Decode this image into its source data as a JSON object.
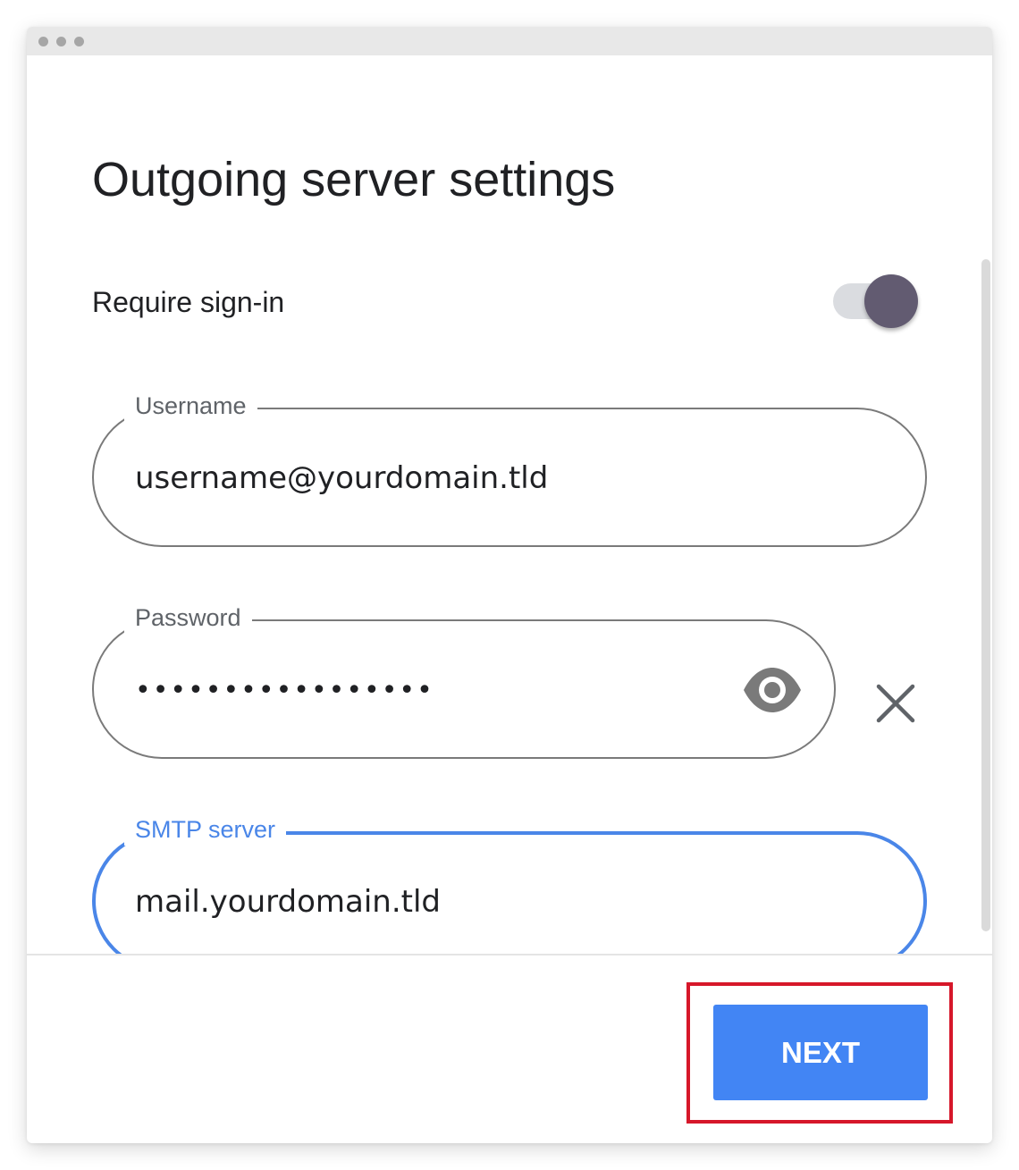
{
  "window": {
    "controls": [
      "window-dot-icon",
      "window-dot-icon",
      "window-dot-icon"
    ]
  },
  "page": {
    "title": "Outgoing server settings"
  },
  "require_signin": {
    "label": "Require sign-in",
    "enabled": true
  },
  "username": {
    "label": "Username",
    "value": "username@yourdomain.tld"
  },
  "password": {
    "label": "Password",
    "value": "•••••••••••••••••",
    "show_icon": "eye-icon",
    "clear_icon": "close-icon"
  },
  "smtp": {
    "label": "SMTP server",
    "value": "mail.yourdomain.tld",
    "focused": true
  },
  "footer": {
    "next_label": "NEXT"
  },
  "colors": {
    "accent": "#4285f4",
    "focus": "#4a86e8",
    "toggle_thumb": "#625b71",
    "highlight": "#d6172a"
  }
}
